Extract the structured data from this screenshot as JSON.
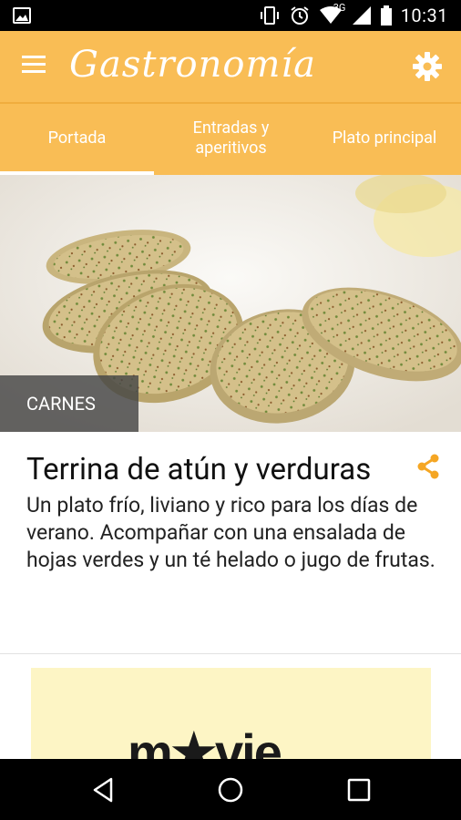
{
  "status_bar": {
    "time": "10:31",
    "network": "3G"
  },
  "app_bar": {
    "title": "Gastronomía"
  },
  "tabs": [
    {
      "label": "Portada",
      "active": true
    },
    {
      "label": "Entradas y aperitivos",
      "active": false
    },
    {
      "label": "Plato principal",
      "active": false
    }
  ],
  "article": {
    "category": "CARNES",
    "title": "Terrina de atún y verduras",
    "description": "Un plato frío, liviano y rico para los días de verano. Acompañar con una ensalada de hojas verdes y un té helado o jugo de frutas."
  },
  "ad": {
    "logo_text": "m★vie"
  },
  "colors": {
    "accent": "#f9bd55",
    "share_icon": "#f5a623",
    "badge": "#464646"
  },
  "icons": {
    "status_left": "image-icon",
    "status_right": [
      "vibrate-icon",
      "alarm-icon",
      "wifi-icon",
      "signal-icon",
      "battery-icon"
    ],
    "menu": "hamburger-menu-icon",
    "settings": "gear-icon",
    "share": "share-icon",
    "nav": [
      "back-icon",
      "home-icon",
      "recents-icon"
    ]
  }
}
